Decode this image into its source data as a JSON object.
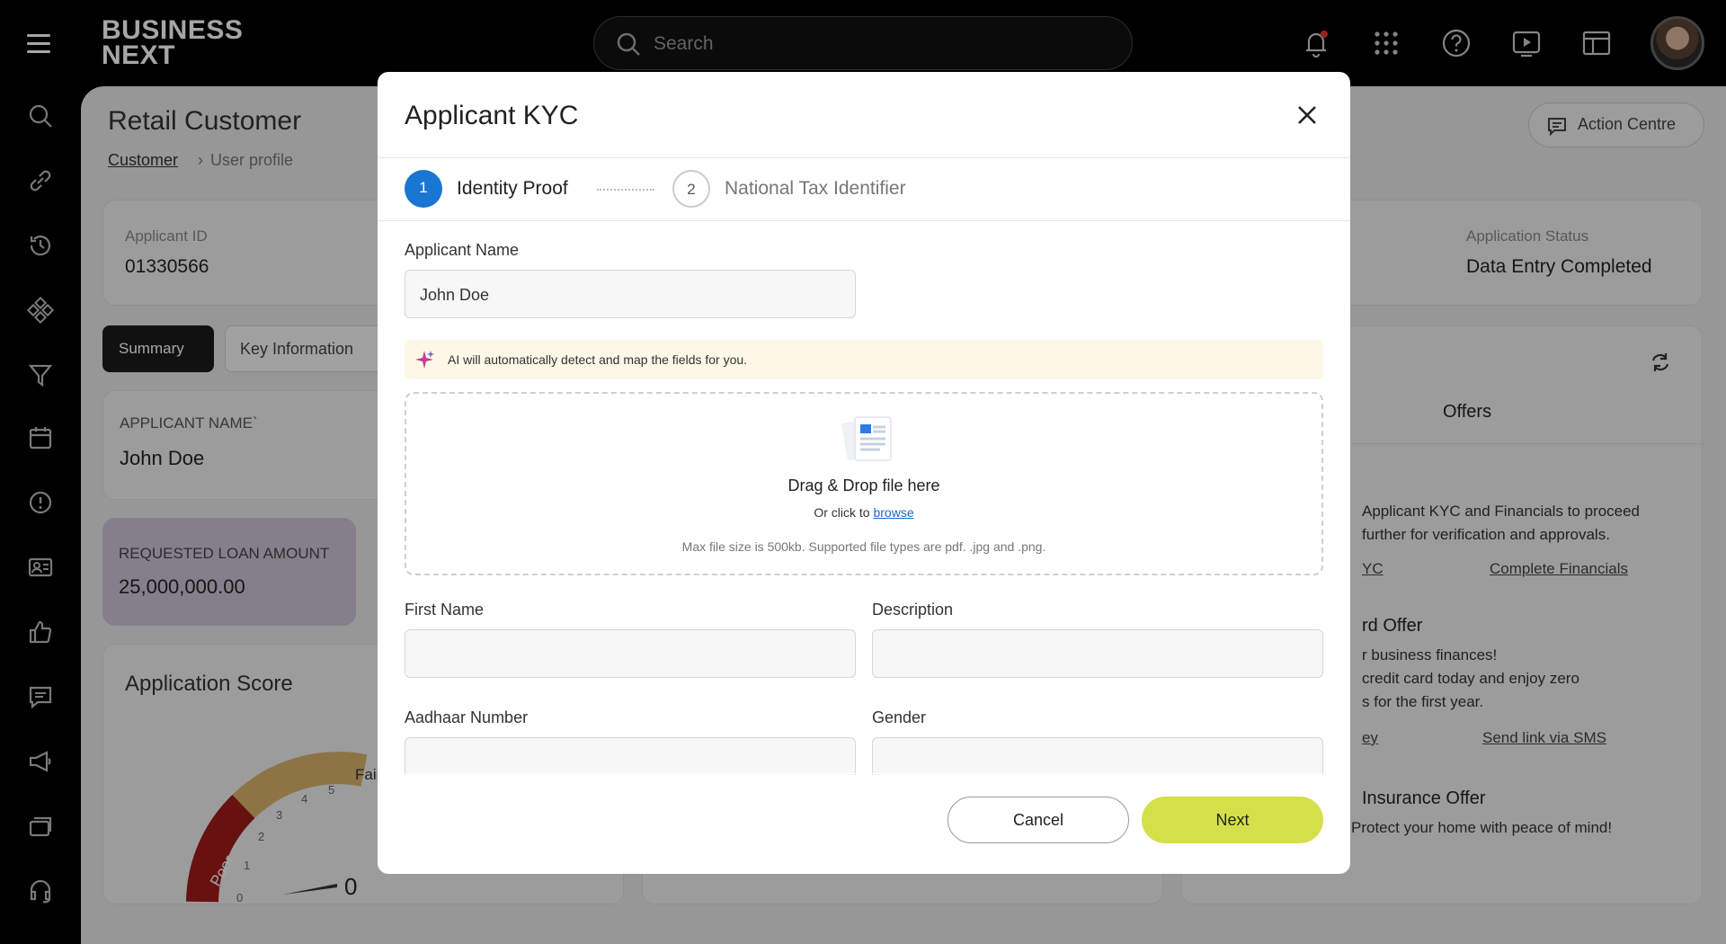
{
  "topbar": {
    "logo_line1": "BUSINESS",
    "logo_line2": "NEXT",
    "search_placeholder": "Search"
  },
  "page": {
    "title": "Retail Customer",
    "breadcrumb_link": "Customer",
    "breadcrumb_current": "User profile",
    "action_centre": "Action Centre"
  },
  "info": {
    "applicant_id_label": "Applicant ID",
    "applicant_id": "01330566",
    "status_label": "Application Status",
    "status": "Data Entry Completed"
  },
  "tabs": {
    "summary": "Summary",
    "key_info": "Key Information"
  },
  "summary": {
    "name_label": "APPLICANT NAME`",
    "name": "John Doe",
    "loan_label": "REQUESTED LOAN AMOUNT",
    "loan": "25,000,000.00",
    "score_title": "Application Score",
    "gauge_fair": "Fair",
    "gauge_poor": "Poor",
    "gauge_value": "0",
    "gauge_ticks": [
      "0",
      "1",
      "2",
      "3",
      "4",
      "5"
    ]
  },
  "right_panel": {
    "offers_tab": "Offers",
    "text1a": "Applicant KYC and Financials to proceed",
    "text1b": "further for verification and approvals.",
    "link_kyc": "YC",
    "link_financials": "Complete Financials",
    "offer_title": "rd Offer",
    "offer_line1": "r business finances!",
    "offer_line2": "credit card today and enjoy zero",
    "offer_line3": "s for the first year.",
    "link_ey": "ey",
    "link_sms": "Send link via SMS",
    "insurance_title": "Insurance Offer",
    "insurance_text": "Protect your home with peace of mind!"
  },
  "modal": {
    "title": "Applicant KYC",
    "step1_num": "1",
    "step1_label": "Identity Proof",
    "step2_num": "2",
    "step2_label": "National Tax Identifier",
    "applicant_name_label": "Applicant Name",
    "applicant_name_value": "John Doe",
    "ai_banner": "AI will automatically detect and map the fields for you.",
    "dz_title": "Drag & Drop file here",
    "dz_or": "Or click to ",
    "dz_browse": "browse",
    "dz_hint": "Max file size is 500kb. Supported file types are pdf. .jpg and .png.",
    "first_name_label": "First Name",
    "description_label": "Description",
    "aadhaar_label": "Aadhaar Number",
    "gender_label": "Gender",
    "cancel": "Cancel",
    "next": "Next"
  },
  "colors": {
    "step_active": "#1976d2",
    "next_button": "#d4e04a",
    "loan_card": "#cbc4d6",
    "ai_banner_bg": "#fdf7e8"
  }
}
